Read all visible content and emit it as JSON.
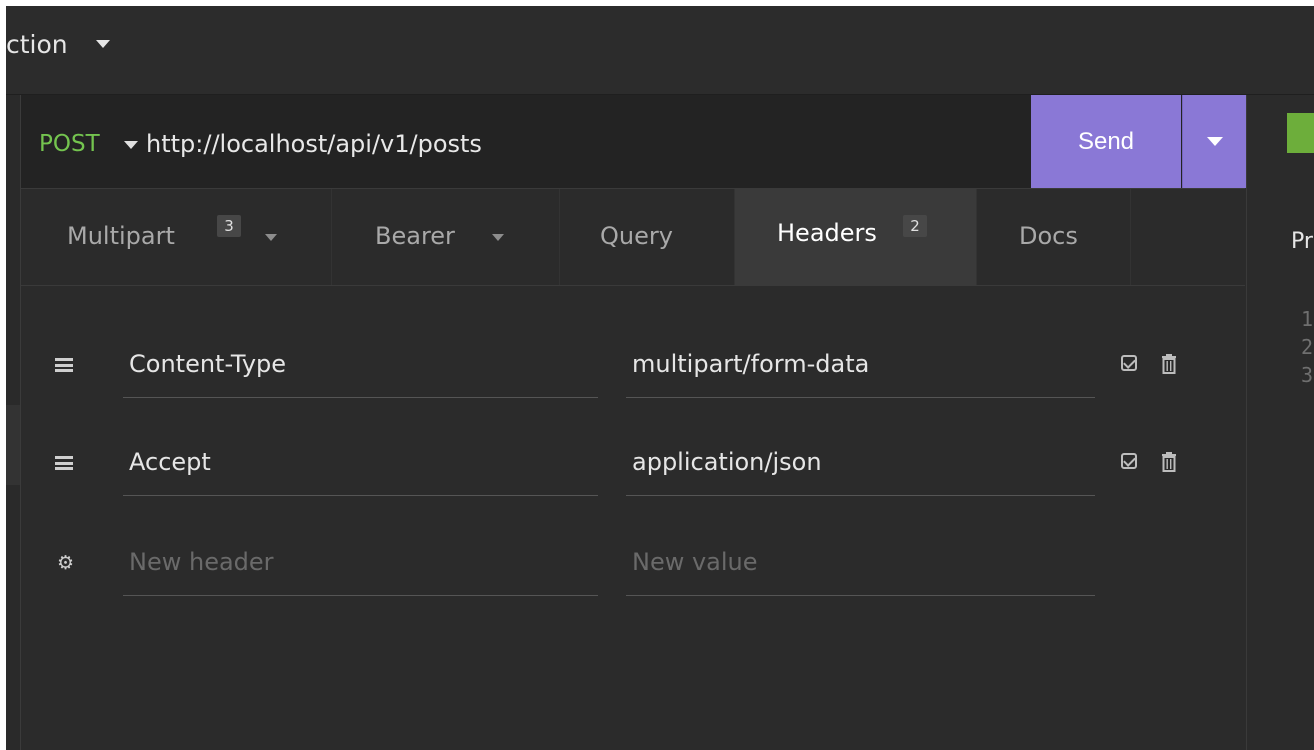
{
  "topbar": {
    "title": "ction"
  },
  "request": {
    "method": "POST",
    "url": "http://localhost/api/v1/posts",
    "send_label": "Send"
  },
  "tabs": [
    {
      "label": "Multipart",
      "badge": "3"
    },
    {
      "label": "Bearer"
    },
    {
      "label": "Query"
    },
    {
      "label": "Headers",
      "badge": "2"
    },
    {
      "label": "Docs"
    }
  ],
  "headers": [
    {
      "name": "Content-Type",
      "value": "multipart/form-data"
    },
    {
      "name": "Accept",
      "value": "application/json"
    }
  ],
  "new_header": {
    "name_placeholder": "New header",
    "value_placeholder": "New value"
  },
  "response_pane": {
    "tab_label": "Pr",
    "line_numbers": [
      "1",
      "2",
      "3"
    ]
  },
  "colors": {
    "method": "#74c44f",
    "send": "#8a78d6",
    "status": "#6dae3b"
  }
}
